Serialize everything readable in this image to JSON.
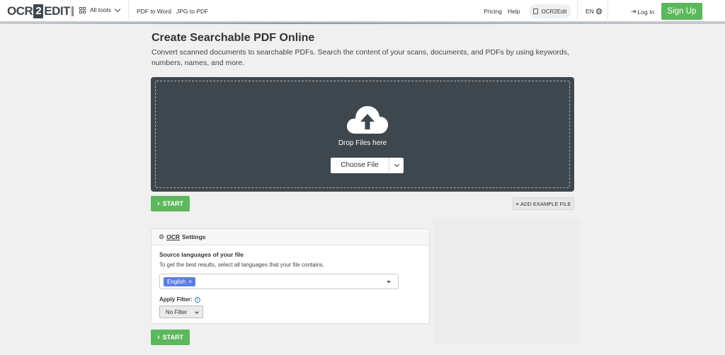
{
  "brand": {
    "logo_left": "OCR",
    "logo_mid": "2",
    "logo_right": "EDIT"
  },
  "nav": {
    "all_tools": "All tools",
    "links": [
      "PDF to Word",
      "JPG to PDF"
    ],
    "pricing": "Pricing",
    "help": "Help",
    "ocr2edit": "OCR2Edit",
    "language": "EN",
    "login": "Log In",
    "signup": "Sign Up"
  },
  "main": {
    "title": "Create Searchable PDF Online",
    "subtitle": "Convert scanned documents to searchable PDFs. Search the content of your scans, documents, and PDFs by using keywords, numbers, names, and more.",
    "drop_text": "Drop Files here",
    "choose_file": "Choose File",
    "start": "START",
    "add_example": "ADD EXAMPLE FILE"
  },
  "settings": {
    "header_prefix": "OCR",
    "header_suffix": "Settings",
    "source_label": "Source languages of your file",
    "source_help": "To get the best results, select all languages that your file contains.",
    "selected_language": "English",
    "filter_label": "Apply Filter:",
    "filter_value": "No Filter"
  },
  "colors": {
    "accent_green": "#5cb85c",
    "dropzone_bg": "#3e474d",
    "tag_blue": "#5b7fe0"
  }
}
